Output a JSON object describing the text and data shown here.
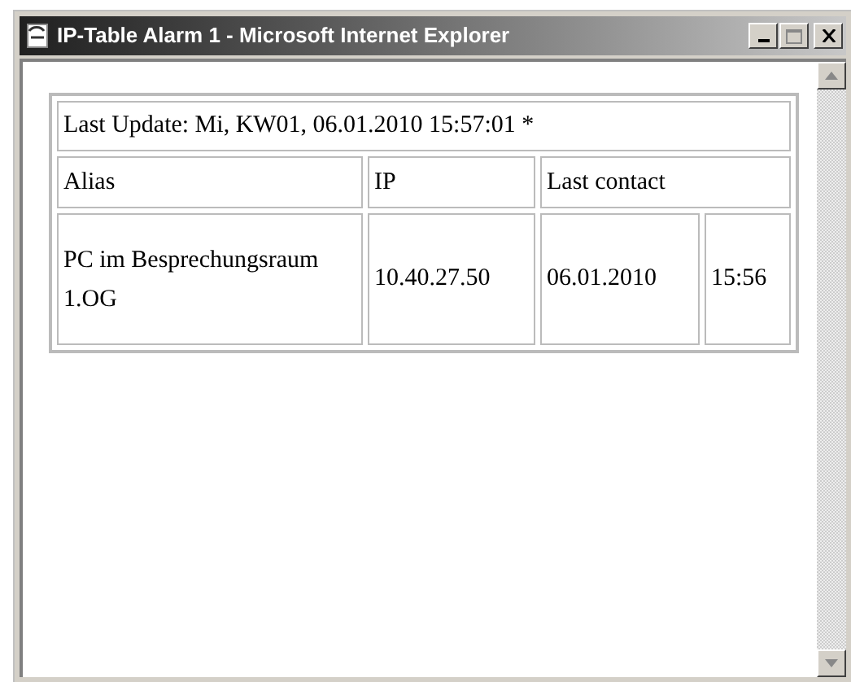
{
  "window": {
    "title": "IP-Table Alarm 1 - Microsoft Internet Explorer"
  },
  "table": {
    "caption": "Last Update: Mi, KW01, 06.01.2010 15:57:01 *",
    "columns": [
      "Alias",
      "IP",
      "Last contact"
    ],
    "rows": [
      {
        "alias": "PC im Besprechungsraum 1.OG",
        "ip": "10.40.27.50",
        "date": "06.01.2010",
        "time": "15:56"
      }
    ]
  }
}
